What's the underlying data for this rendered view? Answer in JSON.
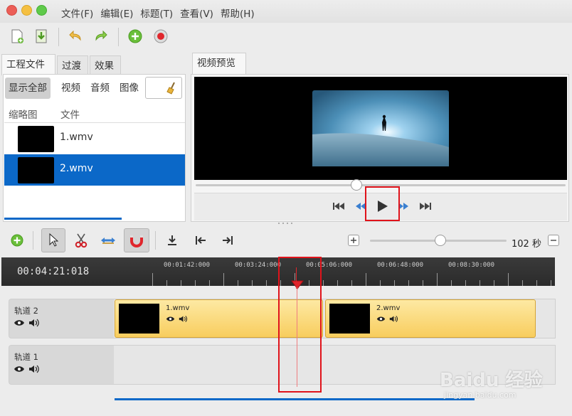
{
  "menu": [
    "文件(F)",
    "编辑(E)",
    "标题(T)",
    "查看(V)",
    "帮助(H)"
  ],
  "left_tabs": [
    "工程文件",
    "过渡",
    "效果"
  ],
  "filters": [
    "显示全部",
    "视频",
    "音频",
    "图像"
  ],
  "file_columns": [
    "缩略图",
    "文件"
  ],
  "files": [
    "1.wmv",
    "2.wmv"
  ],
  "selected_file_index": 1,
  "preview_tab": "视频预览",
  "zoom_value": "102 秒",
  "timecode": "00:04:21:018",
  "ruler_labels": [
    "00:01:42:000",
    "00:03:24:000",
    "00:05:06:000",
    "00:06:48:000",
    "00:08:30:000"
  ],
  "tracks": [
    {
      "name": "轨道 2",
      "clips": [
        "1.wmv",
        "2.wmv"
      ]
    },
    {
      "name": "轨道 1",
      "clips": []
    }
  ],
  "watermark": "Baidu 经验",
  "watermark_url": "jingyan.baidu.com",
  "colors": {
    "selection": "#0b68c8",
    "playhead": "#e0131b",
    "clip": "#f8cd5e",
    "highlight_box": "#e0131b"
  }
}
